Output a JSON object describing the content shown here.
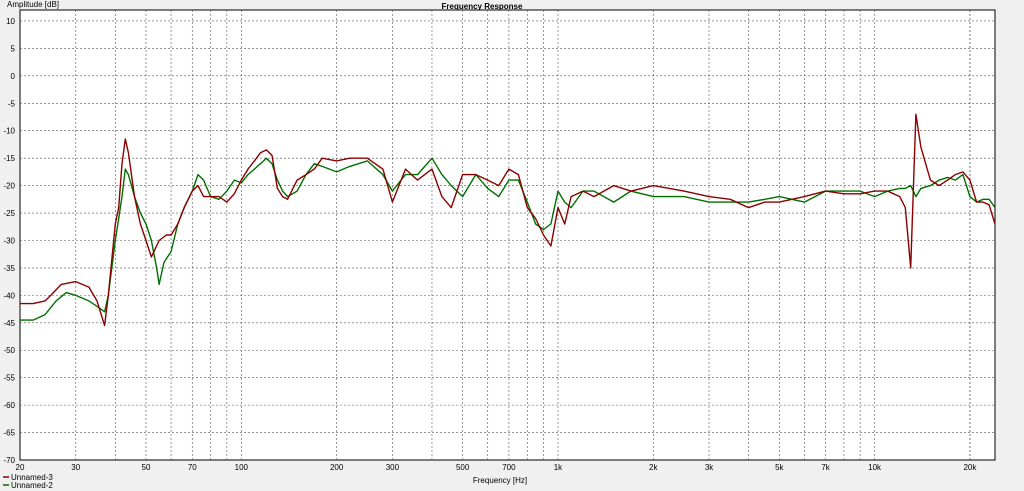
{
  "chart_data": {
    "type": "line",
    "title": "Frequency Response",
    "xlabel": "Frequency [Hz]",
    "ylabel": "Amplitude [dB]",
    "xscale": "log",
    "xlim": [
      20,
      24000
    ],
    "ylim": [
      -70,
      12
    ],
    "grid": true,
    "legend_position": "bottom-left",
    "y_ticks": [
      10,
      5,
      0,
      -5,
      -10,
      -15,
      -20,
      -25,
      -30,
      -35,
      -40,
      -45,
      -50,
      -55,
      -60,
      -65,
      -70
    ],
    "x_ticks": [
      {
        "value": 20,
        "label": "20"
      },
      {
        "value": 30,
        "label": "30"
      },
      {
        "value": 50,
        "label": "50"
      },
      {
        "value": 70,
        "label": "70"
      },
      {
        "value": 100,
        "label": "100"
      },
      {
        "value": 200,
        "label": "200"
      },
      {
        "value": 300,
        "label": "300"
      },
      {
        "value": 500,
        "label": "500"
      },
      {
        "value": 700,
        "label": "700"
      },
      {
        "value": 1000,
        "label": "1k"
      },
      {
        "value": 2000,
        "label": "2k"
      },
      {
        "value": 3000,
        "label": "3k"
      },
      {
        "value": 5000,
        "label": "5k"
      },
      {
        "value": 7000,
        "label": "7k"
      },
      {
        "value": 10000,
        "label": "10k"
      },
      {
        "value": 20000,
        "label": "20k"
      }
    ],
    "series": [
      {
        "name": "Unnamed-3",
        "color": "#8b0000",
        "points": [
          [
            20,
            -41.5
          ],
          [
            22,
            -41.5
          ],
          [
            24,
            -41
          ],
          [
            25,
            -40
          ],
          [
            27,
            -38
          ],
          [
            30,
            -37.5
          ],
          [
            33,
            -38.5
          ],
          [
            35,
            -41
          ],
          [
            37,
            -45.5
          ],
          [
            38,
            -40
          ],
          [
            40,
            -27
          ],
          [
            41,
            -24
          ],
          [
            42,
            -16
          ],
          [
            43,
            -11.5
          ],
          [
            44,
            -14
          ],
          [
            46,
            -22
          ],
          [
            48,
            -27
          ],
          [
            50,
            -30
          ],
          [
            52,
            -33
          ],
          [
            55,
            -30
          ],
          [
            58,
            -29
          ],
          [
            60,
            -29
          ],
          [
            63,
            -27
          ],
          [
            66,
            -24
          ],
          [
            70,
            -21
          ],
          [
            73,
            -20
          ],
          [
            76,
            -22
          ],
          [
            80,
            -22
          ],
          [
            85,
            -22
          ],
          [
            90,
            -23
          ],
          [
            95,
            -21.5
          ],
          [
            100,
            -19
          ],
          [
            105,
            -17
          ],
          [
            110,
            -15.5
          ],
          [
            115,
            -14
          ],
          [
            120,
            -13.5
          ],
          [
            125,
            -14.5
          ],
          [
            130,
            -20.5
          ],
          [
            135,
            -22
          ],
          [
            140,
            -22.5
          ],
          [
            150,
            -19
          ],
          [
            160,
            -18
          ],
          [
            170,
            -17
          ],
          [
            180,
            -15
          ],
          [
            200,
            -15.5
          ],
          [
            220,
            -15
          ],
          [
            250,
            -15
          ],
          [
            280,
            -17
          ],
          [
            300,
            -23
          ],
          [
            330,
            -17
          ],
          [
            360,
            -19
          ],
          [
            400,
            -17
          ],
          [
            430,
            -22
          ],
          [
            460,
            -24
          ],
          [
            500,
            -18
          ],
          [
            550,
            -18
          ],
          [
            600,
            -19
          ],
          [
            650,
            -20
          ],
          [
            700,
            -17
          ],
          [
            750,
            -18
          ],
          [
            800,
            -24
          ],
          [
            850,
            -26
          ],
          [
            900,
            -29
          ],
          [
            950,
            -31
          ],
          [
            1000,
            -24
          ],
          [
            1050,
            -27
          ],
          [
            1100,
            -22
          ],
          [
            1200,
            -21
          ],
          [
            1300,
            -22
          ],
          [
            1500,
            -20
          ],
          [
            1700,
            -21
          ],
          [
            2000,
            -20
          ],
          [
            2500,
            -21
          ],
          [
            3000,
            -22
          ],
          [
            3500,
            -22.5
          ],
          [
            4000,
            -24
          ],
          [
            4500,
            -23
          ],
          [
            5000,
            -23
          ],
          [
            6000,
            -22
          ],
          [
            7000,
            -21
          ],
          [
            8000,
            -21.5
          ],
          [
            9000,
            -21.5
          ],
          [
            10000,
            -21
          ],
          [
            11000,
            -21
          ],
          [
            12000,
            -22
          ],
          [
            12500,
            -24
          ],
          [
            13000,
            -35
          ],
          [
            13500,
            -7
          ],
          [
            14000,
            -13
          ],
          [
            15000,
            -19
          ],
          [
            16000,
            -20
          ],
          [
            17000,
            -19
          ],
          [
            18000,
            -18
          ],
          [
            19000,
            -17.5
          ],
          [
            20000,
            -19
          ],
          [
            21000,
            -23
          ],
          [
            22000,
            -23
          ],
          [
            23000,
            -23.5
          ],
          [
            24000,
            -27
          ]
        ]
      },
      {
        "name": "Unnamed-2",
        "color": "#007000",
        "points": [
          [
            20,
            -44.5
          ],
          [
            22,
            -44.5
          ],
          [
            24,
            -43.5
          ],
          [
            26,
            -41
          ],
          [
            28,
            -39.5
          ],
          [
            30,
            -40
          ],
          [
            33,
            -41
          ],
          [
            35,
            -42
          ],
          [
            37,
            -43
          ],
          [
            38,
            -40
          ],
          [
            40,
            -30
          ],
          [
            41,
            -26
          ],
          [
            42,
            -22
          ],
          [
            43,
            -17
          ],
          [
            44,
            -18
          ],
          [
            46,
            -22
          ],
          [
            48,
            -25
          ],
          [
            50,
            -27
          ],
          [
            52,
            -30
          ],
          [
            54,
            -35
          ],
          [
            55,
            -38
          ],
          [
            57,
            -34
          ],
          [
            60,
            -32
          ],
          [
            63,
            -27
          ],
          [
            66,
            -24
          ],
          [
            70,
            -21
          ],
          [
            73,
            -18
          ],
          [
            76,
            -19
          ],
          [
            80,
            -22
          ],
          [
            85,
            -22.5
          ],
          [
            90,
            -21
          ],
          [
            95,
            -19
          ],
          [
            100,
            -19.5
          ],
          [
            105,
            -18
          ],
          [
            110,
            -17
          ],
          [
            115,
            -16
          ],
          [
            120,
            -15
          ],
          [
            125,
            -16
          ],
          [
            130,
            -19
          ],
          [
            135,
            -21
          ],
          [
            140,
            -22
          ],
          [
            150,
            -21
          ],
          [
            160,
            -18
          ],
          [
            170,
            -16
          ],
          [
            180,
            -16.5
          ],
          [
            200,
            -17.5
          ],
          [
            220,
            -16.5
          ],
          [
            250,
            -15.5
          ],
          [
            280,
            -18
          ],
          [
            300,
            -21
          ],
          [
            330,
            -18
          ],
          [
            360,
            -18
          ],
          [
            400,
            -15
          ],
          [
            430,
            -18
          ],
          [
            460,
            -20
          ],
          [
            500,
            -22
          ],
          [
            550,
            -18
          ],
          [
            600,
            -20.5
          ],
          [
            650,
            -22
          ],
          [
            700,
            -19
          ],
          [
            750,
            -19
          ],
          [
            800,
            -23
          ],
          [
            850,
            -27
          ],
          [
            900,
            -28
          ],
          [
            950,
            -27
          ],
          [
            1000,
            -21
          ],
          [
            1050,
            -23
          ],
          [
            1100,
            -24
          ],
          [
            1200,
            -21
          ],
          [
            1300,
            -21
          ],
          [
            1500,
            -23
          ],
          [
            1700,
            -21
          ],
          [
            2000,
            -22
          ],
          [
            2500,
            -22
          ],
          [
            3000,
            -23
          ],
          [
            3500,
            -23
          ],
          [
            4000,
            -23
          ],
          [
            4500,
            -22.5
          ],
          [
            5000,
            -22
          ],
          [
            6000,
            -23
          ],
          [
            7000,
            -21
          ],
          [
            8000,
            -21
          ],
          [
            9000,
            -21
          ],
          [
            10000,
            -22
          ],
          [
            11000,
            -21
          ],
          [
            12000,
            -20.5
          ],
          [
            12500,
            -20.5
          ],
          [
            13000,
            -20
          ],
          [
            13500,
            -22
          ],
          [
            14000,
            -20.5
          ],
          [
            15000,
            -20
          ],
          [
            16000,
            -19
          ],
          [
            17000,
            -18.5
          ],
          [
            18000,
            -19
          ],
          [
            19000,
            -18
          ],
          [
            20000,
            -22
          ],
          [
            21000,
            -23
          ],
          [
            22000,
            -22.5
          ],
          [
            23000,
            -22.5
          ],
          [
            24000,
            -24
          ]
        ]
      }
    ]
  }
}
